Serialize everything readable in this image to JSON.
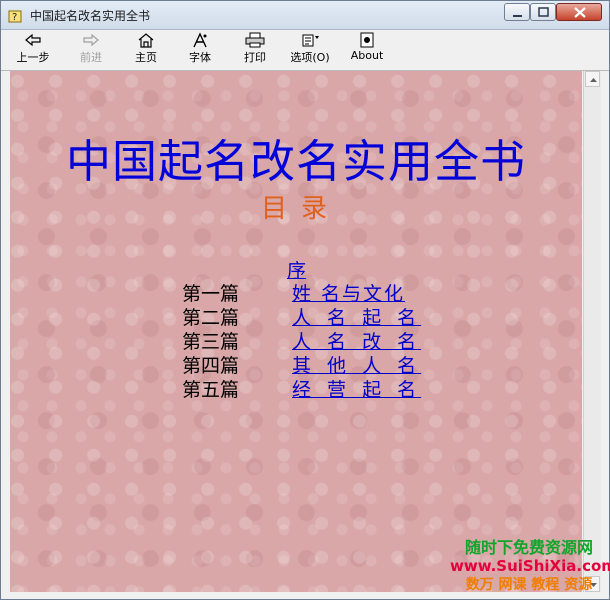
{
  "window": {
    "title": "中国起名改名实用全书"
  },
  "toolbar": {
    "back_label": "上一步",
    "forward_label": "前进",
    "home_label": "主页",
    "font_label": "字体",
    "print_label": "打印",
    "options_label": "选项(O)",
    "about_label": "About"
  },
  "content": {
    "book_title": "中国起名改名实用全书",
    "toc_heading": "目录",
    "preface_link": "序",
    "chapters": [
      {
        "part": "第一篇",
        "link": "姓 名与文化"
      },
      {
        "part": "第二篇",
        "link": "人 名 起 名"
      },
      {
        "part": "第三篇",
        "link": "人 名 改 名"
      },
      {
        "part": "第四篇",
        "link": "其 他 人 名"
      },
      {
        "part": "第五篇",
        "link": "经 营 起 名"
      }
    ]
  },
  "watermark": {
    "line1": "随时下免费资源网",
    "line2": "www.SuiShiXia.com",
    "line3": "数万 网课 教程 资源"
  },
  "colors": {
    "title_blue": "#0000d8",
    "heading_orange": "#e0601c",
    "link_blue": "#0000cc",
    "page_background": "#d9a7a8"
  }
}
